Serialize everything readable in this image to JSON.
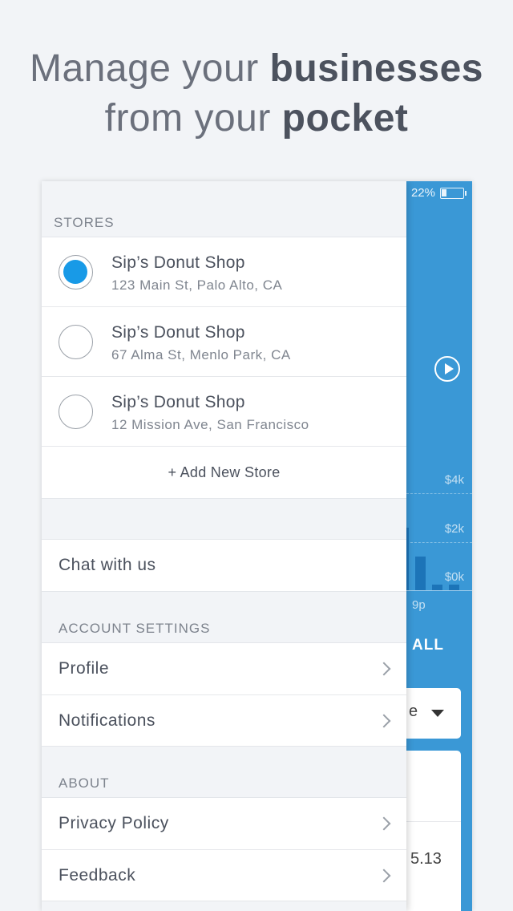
{
  "headline": {
    "line1_normal": "Manage your ",
    "line1_bold": "businesses",
    "line2_normal": "from your ",
    "line2_bold": "pocket"
  },
  "background_app": {
    "battery_percent": "22%",
    "y_labels": [
      "$4k",
      "$2k",
      "$0k"
    ],
    "x_label": "9p",
    "all_label": "ALL",
    "select_value": "e",
    "amount_fragment": "5.13",
    "accent_color": "#3a98d6"
  },
  "drawer": {
    "stores_header": "STORES",
    "stores": [
      {
        "name": "Sip’s Donut Shop",
        "address": "123 Main St, Palo Alto, CA",
        "selected": true
      },
      {
        "name": "Sip’s Donut Shop",
        "address": "67 Alma St, Menlo Park, CA",
        "selected": false
      },
      {
        "name": "Sip’s Donut Shop",
        "address": "12 Mission Ave, San Francisco",
        "selected": false
      }
    ],
    "add_store_label": "+ Add New Store",
    "chat_label": "Chat with us",
    "account_header": "ACCOUNT SETTINGS",
    "account_items": [
      "Profile",
      "Notifications"
    ],
    "about_header": "ABOUT",
    "about_items": [
      "Privacy Policy",
      "Feedback"
    ]
  }
}
